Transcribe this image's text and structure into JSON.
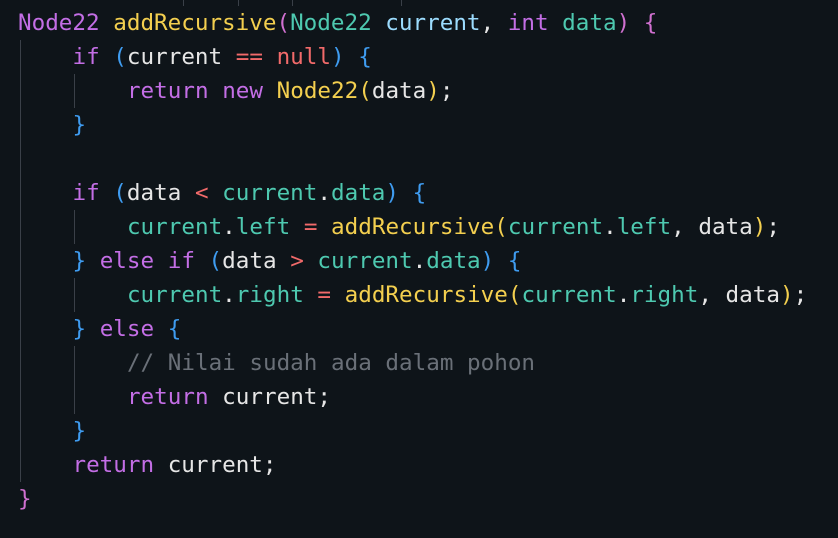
{
  "colors": {
    "background": "#0e1419",
    "keyword": "#c36ee5",
    "type": "#4ec9b0",
    "function": "#f3cf4f",
    "variable": "#9cdcfe",
    "plain": "#e6e6e6",
    "operator": "#f16a6a",
    "null_literal": "#f16a6a",
    "bracket_level1": "#f3cf4f",
    "bracket_level2": "#d070d0",
    "bracket_level3": "#3f9cf0",
    "comment": "#6a7078",
    "indent_guide": "#3a4048"
  },
  "code": {
    "lines": [
      {
        "indent": 0,
        "tokens": [
          {
            "t": "Node22",
            "c": "keyword"
          },
          {
            "t": " ",
            "c": "plain"
          },
          {
            "t": "addRecursive",
            "c": "function"
          },
          {
            "t": "(",
            "c": "bracket_level2"
          },
          {
            "t": "Node22",
            "c": "type"
          },
          {
            "t": " current",
            "c": "variable"
          },
          {
            "t": ", ",
            "c": "plain"
          },
          {
            "t": "int",
            "c": "keyword"
          },
          {
            "t": " data",
            "c": "type"
          },
          {
            "t": ")",
            "c": "bracket_level2"
          },
          {
            "t": " ",
            "c": "plain"
          },
          {
            "t": "{",
            "c": "bracket_level2"
          }
        ]
      },
      {
        "indent": 1,
        "tokens": [
          {
            "t": "if",
            "c": "keyword"
          },
          {
            "t": " ",
            "c": "plain"
          },
          {
            "t": "(",
            "c": "bracket_level3"
          },
          {
            "t": "current",
            "c": "plain"
          },
          {
            "t": " ",
            "c": "plain"
          },
          {
            "t": "==",
            "c": "operator"
          },
          {
            "t": " ",
            "c": "plain"
          },
          {
            "t": "null",
            "c": "null_literal"
          },
          {
            "t": ")",
            "c": "bracket_level3"
          },
          {
            "t": " ",
            "c": "plain"
          },
          {
            "t": "{",
            "c": "bracket_level3"
          }
        ]
      },
      {
        "indent": 2,
        "tokens": [
          {
            "t": "return",
            "c": "keyword"
          },
          {
            "t": " ",
            "c": "plain"
          },
          {
            "t": "new",
            "c": "keyword"
          },
          {
            "t": " ",
            "c": "plain"
          },
          {
            "t": "Node22",
            "c": "function"
          },
          {
            "t": "(",
            "c": "bracket_level1"
          },
          {
            "t": "data",
            "c": "plain"
          },
          {
            "t": ")",
            "c": "bracket_level1"
          },
          {
            "t": ";",
            "c": "plain"
          }
        ]
      },
      {
        "indent": 1,
        "tokens": [
          {
            "t": "}",
            "c": "bracket_level3"
          }
        ]
      },
      {
        "indent": 0,
        "tokens": []
      },
      {
        "indent": 1,
        "tokens": [
          {
            "t": "if",
            "c": "keyword"
          },
          {
            "t": " ",
            "c": "plain"
          },
          {
            "t": "(",
            "c": "bracket_level3"
          },
          {
            "t": "data",
            "c": "plain"
          },
          {
            "t": " ",
            "c": "plain"
          },
          {
            "t": "<",
            "c": "operator"
          },
          {
            "t": " ",
            "c": "plain"
          },
          {
            "t": "current",
            "c": "type"
          },
          {
            "t": ".",
            "c": "plain"
          },
          {
            "t": "data",
            "c": "type"
          },
          {
            "t": ")",
            "c": "bracket_level3"
          },
          {
            "t": " ",
            "c": "plain"
          },
          {
            "t": "{",
            "c": "bracket_level3"
          }
        ]
      },
      {
        "indent": 2,
        "tokens": [
          {
            "t": "current",
            "c": "type"
          },
          {
            "t": ".",
            "c": "plain"
          },
          {
            "t": "left",
            "c": "type"
          },
          {
            "t": " ",
            "c": "plain"
          },
          {
            "t": "=",
            "c": "operator"
          },
          {
            "t": " ",
            "c": "plain"
          },
          {
            "t": "addRecursive",
            "c": "function"
          },
          {
            "t": "(",
            "c": "bracket_level1"
          },
          {
            "t": "current",
            "c": "type"
          },
          {
            "t": ".",
            "c": "plain"
          },
          {
            "t": "left",
            "c": "type"
          },
          {
            "t": ", ",
            "c": "plain"
          },
          {
            "t": "data",
            "c": "plain"
          },
          {
            "t": ")",
            "c": "bracket_level1"
          },
          {
            "t": ";",
            "c": "plain"
          }
        ]
      },
      {
        "indent": 1,
        "tokens": [
          {
            "t": "}",
            "c": "bracket_level3"
          },
          {
            "t": " ",
            "c": "plain"
          },
          {
            "t": "else",
            "c": "keyword"
          },
          {
            "t": " ",
            "c": "plain"
          },
          {
            "t": "if",
            "c": "keyword"
          },
          {
            "t": " ",
            "c": "plain"
          },
          {
            "t": "(",
            "c": "bracket_level3"
          },
          {
            "t": "data",
            "c": "plain"
          },
          {
            "t": " ",
            "c": "plain"
          },
          {
            "t": ">",
            "c": "operator"
          },
          {
            "t": " ",
            "c": "plain"
          },
          {
            "t": "current",
            "c": "type"
          },
          {
            "t": ".",
            "c": "plain"
          },
          {
            "t": "data",
            "c": "type"
          },
          {
            "t": ")",
            "c": "bracket_level3"
          },
          {
            "t": " ",
            "c": "plain"
          },
          {
            "t": "{",
            "c": "bracket_level3"
          }
        ]
      },
      {
        "indent": 2,
        "tokens": [
          {
            "t": "current",
            "c": "type"
          },
          {
            "t": ".",
            "c": "plain"
          },
          {
            "t": "right",
            "c": "type"
          },
          {
            "t": " ",
            "c": "plain"
          },
          {
            "t": "=",
            "c": "operator"
          },
          {
            "t": " ",
            "c": "plain"
          },
          {
            "t": "addRecursive",
            "c": "function"
          },
          {
            "t": "(",
            "c": "bracket_level1"
          },
          {
            "t": "current",
            "c": "type"
          },
          {
            "t": ".",
            "c": "plain"
          },
          {
            "t": "right",
            "c": "type"
          },
          {
            "t": ", ",
            "c": "plain"
          },
          {
            "t": "data",
            "c": "plain"
          },
          {
            "t": ")",
            "c": "bracket_level1"
          },
          {
            "t": ";",
            "c": "plain"
          }
        ]
      },
      {
        "indent": 1,
        "tokens": [
          {
            "t": "}",
            "c": "bracket_level3"
          },
          {
            "t": " ",
            "c": "plain"
          },
          {
            "t": "else",
            "c": "keyword"
          },
          {
            "t": " ",
            "c": "plain"
          },
          {
            "t": "{",
            "c": "bracket_level3"
          }
        ]
      },
      {
        "indent": 2,
        "tokens": [
          {
            "t": "// Nilai sudah ada dalam pohon",
            "c": "comment"
          }
        ]
      },
      {
        "indent": 2,
        "tokens": [
          {
            "t": "return",
            "c": "keyword"
          },
          {
            "t": " current;",
            "c": "plain"
          }
        ]
      },
      {
        "indent": 1,
        "tokens": [
          {
            "t": "}",
            "c": "bracket_level3"
          }
        ]
      },
      {
        "indent": 1,
        "tokens": [
          {
            "t": "return",
            "c": "keyword"
          },
          {
            "t": " current;",
            "c": "plain"
          }
        ]
      },
      {
        "indent": 0,
        "tokens": [
          {
            "t": "}",
            "c": "bracket_level2"
          }
        ]
      }
    ]
  }
}
